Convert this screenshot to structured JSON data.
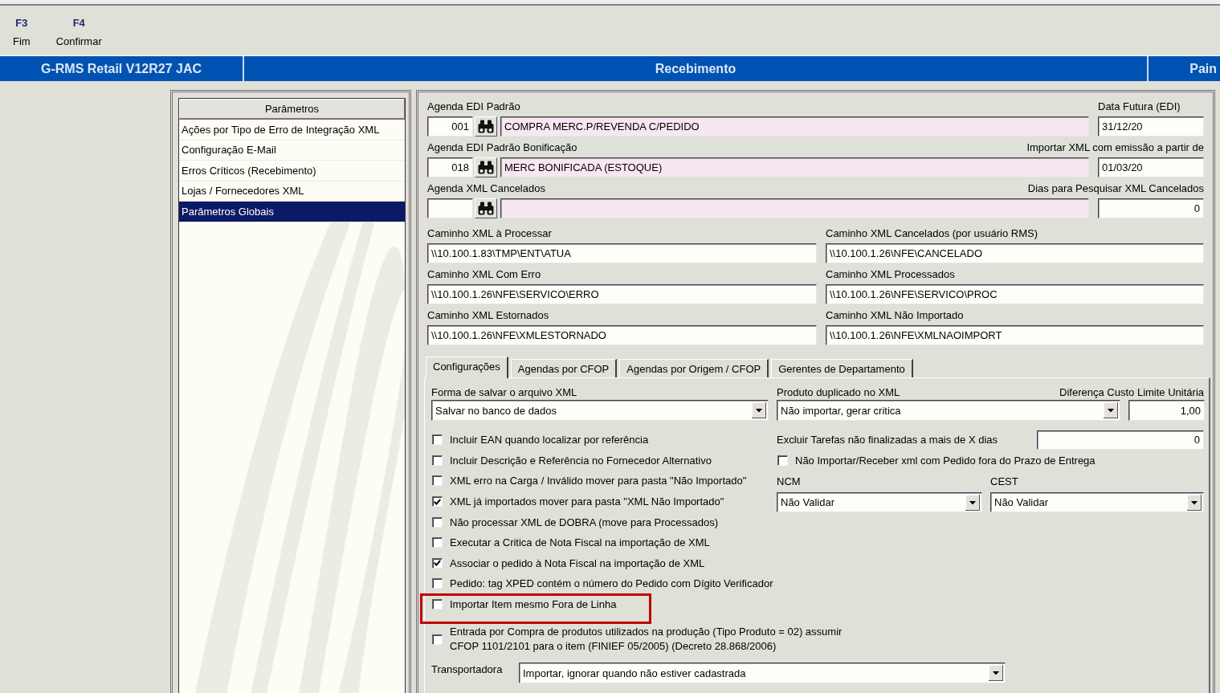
{
  "toolbar": [
    {
      "key": "F3",
      "label": "Fim"
    },
    {
      "key": "F4",
      "label": "Confirmar"
    }
  ],
  "title_bar": {
    "segments": [
      "G-RMS Retail V12R27 JAC",
      "Recebimento",
      "Pain"
    ]
  },
  "parameters_list": {
    "header": "Parâmetros",
    "items": [
      {
        "label": "Ações por Tipo de Erro de Integração XML",
        "selected": false
      },
      {
        "label": "Configuração E-Mail",
        "selected": false
      },
      {
        "label": "Erros Críticos (Recebimento)",
        "selected": false
      },
      {
        "label": "Lojas / Fornecedores XML",
        "selected": false
      },
      {
        "label": "Parâmetros Globais",
        "selected": true
      }
    ]
  },
  "agenda_rows": [
    {
      "label": "Agenda EDI Padrão",
      "code": "001",
      "description": "COMPRA MERC.P/REVENDA C/PEDIDO",
      "side": {
        "kind": "date",
        "label": "Data Futura (EDI)",
        "value": "31/12/20"
      }
    },
    {
      "label": "Agenda EDI Padrão Bonificação",
      "code": "018",
      "description": "MERC BONIFICADA (ESTOQUE)",
      "side": {
        "kind": "date",
        "label": "Importar XML com emissão a partir de",
        "value": "01/03/20"
      }
    },
    {
      "label": "Agenda XML Cancelados",
      "side": {
        "kind": "number",
        "label": "Dias para Pesquisar XML Cancelados",
        "value": "0"
      }
    }
  ],
  "path_fields": [
    {
      "label": "Caminho XML à Processar",
      "value": "\\\\10.100.1.83\\TMP\\ENT\\ATUA"
    },
    {
      "label": "Caminho XML Cancelados (por usuário RMS)",
      "value": "\\\\10.100.1.26\\NFE\\CANCELADO"
    },
    {
      "label": "Caminho XML Com Erro",
      "value": "\\\\10.100.1.26\\NFE\\SERVICO\\ERRO"
    },
    {
      "label": "Caminho XML Processados",
      "value": "\\\\10.100.1.26\\NFE\\SERVICO\\PROC"
    },
    {
      "label": "Caminho XML Estornados",
      "value": "\\\\10.100.1.26\\NFE\\XMLESTORNADO"
    },
    {
      "label": "Caminho XML Não Importado",
      "value": "\\\\10.100.1.26\\NFE\\XMLNAOIMPORT"
    }
  ],
  "tabs": [
    {
      "label": "Configurações",
      "selected": true
    },
    {
      "label": "Agendas por CFOP",
      "selected": false
    },
    {
      "label": "Agendas por Origem / CFOP",
      "selected": false
    },
    {
      "label": "Gerentes de Departamento",
      "selected": false
    }
  ],
  "configuracoes": {
    "save_mode": {
      "label": "Forma de salvar o arquivo XML",
      "value": "Salvar no banco de dados"
    },
    "duplicate_product": {
      "label": "Produto duplicado no XML",
      "value": "Não importar, gerar critica"
    },
    "cost_limit": {
      "label": "Diferença Custo Limite Unitária",
      "value": "1,00"
    },
    "options": [
      {
        "label": "Incluir EAN quando localizar por referência",
        "checked": false,
        "highlighted": false
      },
      {
        "label": "Incluir Descrição e Referência no Fornecedor Alternativo",
        "checked": false,
        "highlighted": false
      },
      {
        "label": "XML erro na Carga / Inválido mover para pasta \"Não Importado\"",
        "checked": false,
        "highlighted": false
      },
      {
        "label": "XML já importados mover para pasta \"XML Não Importado\"",
        "checked": true,
        "highlighted": false
      },
      {
        "label": "Não processar XML de DOBRA (move para Processados)",
        "checked": false,
        "highlighted": false
      },
      {
        "label": "Executar a Critica de Nota Fiscal na importação de XML",
        "checked": false,
        "highlighted": false
      },
      {
        "label": "Associar o pedido à Nota Fiscal na importação de XML",
        "checked": true,
        "highlighted": false
      },
      {
        "label": "Pedido: tag XPED contém o número do Pedido com Dígito Verificador",
        "checked": false,
        "highlighted": false
      },
      {
        "label": "Importar Item mesmo Fora de Linha",
        "checked": false,
        "highlighted": true
      }
    ],
    "exclude_tasks": {
      "label": "Excluir Tarefas não finalizadas a mais de X dias",
      "value": "0"
    },
    "late_order_option": {
      "label": "Não Importar/Receber xml com Pedido fora do Prazo de Entrega",
      "checked": false
    },
    "ncm": {
      "label": "NCM",
      "value": "Não Validar"
    },
    "cest": {
      "label": "CEST",
      "value": "Não Validar"
    },
    "production_option": {
      "label": "Entrada por Compra de produtos utilizados na produção (Tipo Produto = 02) assumir CFOP 1101/2101 para o item (FINIEF 05/2005) (Decreto 28.868/2006)",
      "checked": false
    },
    "carrier": {
      "label": "Transportadora",
      "value": "Importar, ignorar quando não estiver cadastrada"
    }
  }
}
